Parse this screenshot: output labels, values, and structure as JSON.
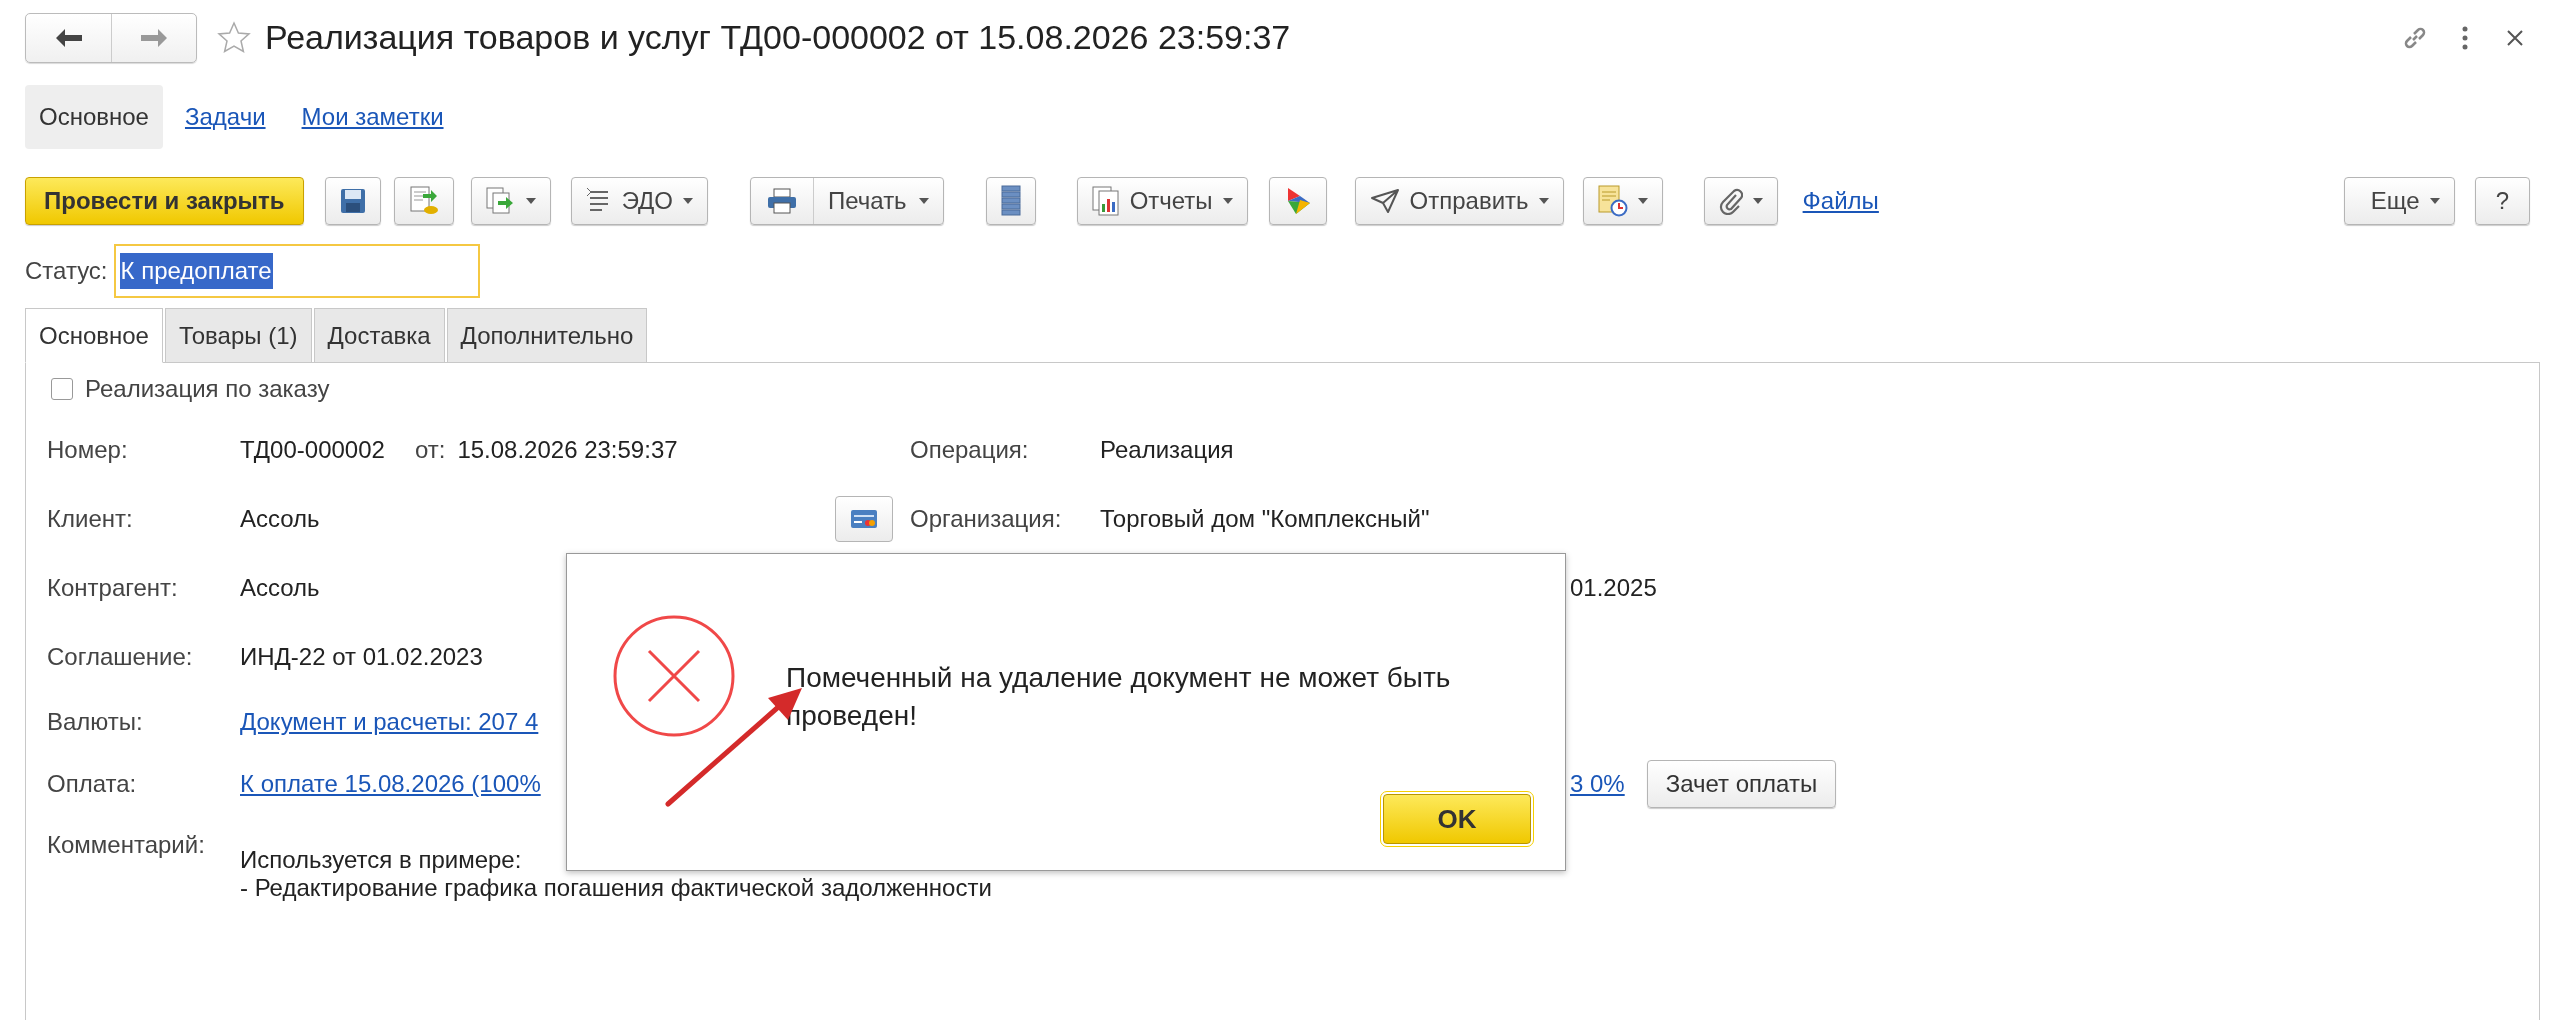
{
  "window": {
    "title": "Реализация товаров и услуг ТД00-000002 от 15.08.2026 23:59:37"
  },
  "nav_tabs": [
    {
      "label": "Основное",
      "selected": true
    },
    {
      "label": "Задачи",
      "selected": false
    },
    {
      "label": "Мои заметки",
      "selected": false
    }
  ],
  "toolbar": [
    {
      "kind": "primary",
      "label": "Провести и закрыть"
    },
    {
      "kind": "icon"
    },
    {
      "kind": "icon"
    },
    {
      "kind": "icon-dropdown"
    },
    {
      "kind": "icon-label-dropdown",
      "label": "ЭДО"
    },
    {
      "kind": "split",
      "label": "Печать"
    },
    {
      "kind": "icon"
    },
    {
      "kind": "icon-label-dropdown",
      "label": "Отчеты"
    },
    {
      "kind": "icon"
    },
    {
      "kind": "icon-label-dropdown",
      "label": "Отправить"
    },
    {
      "kind": "icon-dropdown"
    },
    {
      "kind": "icon-dropdown"
    },
    {
      "kind": "link",
      "label": "Файлы"
    }
  ],
  "toolbar_right": [
    {
      "kind": "label-dropdown",
      "label": "Еще"
    },
    {
      "kind": "label",
      "label": "?"
    }
  ],
  "status": {
    "label": "Статус:",
    "value": "К предоплате"
  },
  "form_tabs": [
    {
      "label": "Основное",
      "selected": true
    },
    {
      "label": "Товары (1)",
      "selected": false
    },
    {
      "label": "Доставка",
      "selected": false
    },
    {
      "label": "Дополнительно",
      "selected": false
    }
  ],
  "order_checkbox": {
    "label": "Реализация по заказу",
    "checked": false
  },
  "rows": [
    {
      "label": "Номер:",
      "main": [
        {
          "kind": "value",
          "text": "ТД00-000002"
        },
        {
          "kind": "sub-label",
          "text": "от:"
        },
        {
          "kind": "value",
          "text": "15.08.2026 23:59:37"
        }
      ],
      "side_label": "Операция:",
      "side_value": "Реализация"
    },
    {
      "label": "Клиент:",
      "main": [
        {
          "kind": "value",
          "text": "Ассоль"
        }
      ],
      "card_button": true,
      "side_label": "Организация:",
      "side_value": "Торговый дом \"Комплексный\""
    },
    {
      "label": "Контрагент:",
      "main": [
        {
          "kind": "value",
          "text": "Ассоль"
        }
      ],
      "tail": [
        {
          "kind": "value",
          "text": "01.2025"
        }
      ]
    },
    {
      "label": "Соглашение:",
      "main": [
        {
          "kind": "value",
          "text": "ИНД-22 от 01.02.2023"
        }
      ]
    },
    {
      "label": "Валюты:",
      "main": [
        {
          "kind": "link",
          "text": "Документ и расчеты: 207 4"
        }
      ]
    },
    {
      "label": "Оплата:",
      "main": [
        {
          "kind": "link",
          "text": "К оплате 15.08.2026 (100%"
        }
      ],
      "tail": [
        {
          "kind": "link",
          "text": "3 0%"
        },
        {
          "kind": "button",
          "text": "Зачет оплаты"
        }
      ]
    }
  ],
  "comment": {
    "label": "Комментарий:",
    "lines": [
      "Используется в примере:",
      "- Редактирование графика погашения фактической задолженности"
    ]
  },
  "dialog": {
    "message": "Помеченный на удаление документ не может быть проведен!",
    "button": "OK"
  }
}
